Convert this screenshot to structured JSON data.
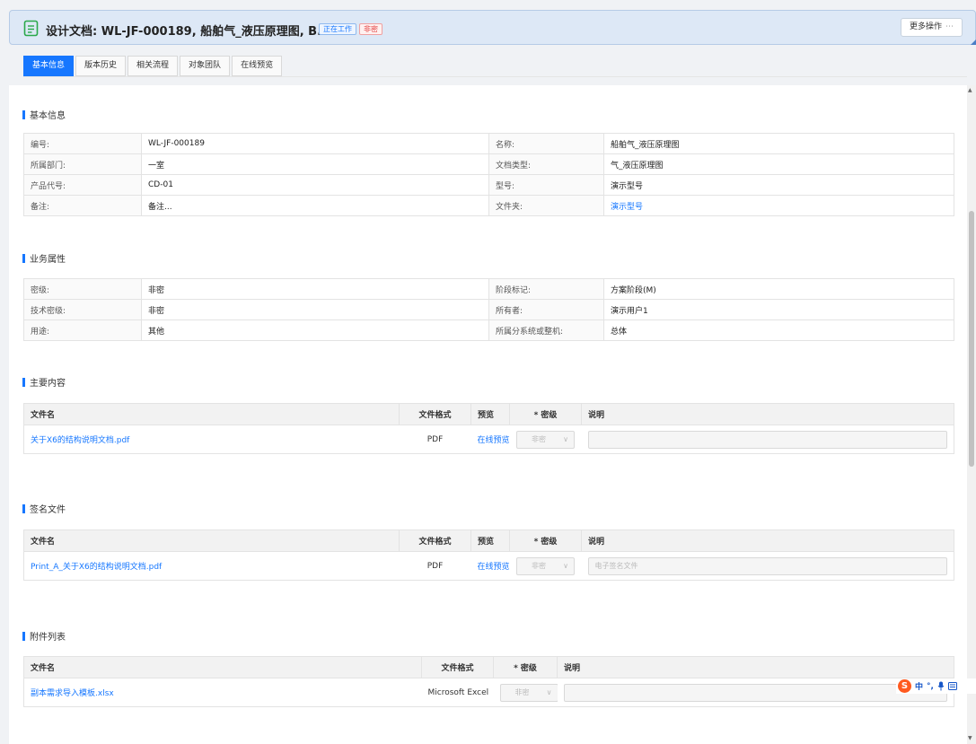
{
  "header": {
    "title": "设计文档: WL-JF-000189, 船舶气_液压原理图, B.1",
    "status_badge": "正在工作",
    "secret_badge": "非密",
    "more_button": "更多操作",
    "more_dots": "⋯",
    "colors": {
      "accent": "#1677ff",
      "header_bg": "#dde8f6",
      "danger": "#e23c3c"
    }
  },
  "tabs": [
    "基本信息",
    "版本历史",
    "相关流程",
    "对象团队",
    "在线预览"
  ],
  "basic_info": {
    "title": "基本信息",
    "rows": [
      {
        "l1": "编号:",
        "v1": "WL-JF-000189",
        "l2": "名称:",
        "v2": "船舶气_液压原理图"
      },
      {
        "l1": "所属部门:",
        "v1": "一室",
        "l2": "文档类型:",
        "v2": "气_液压原理图"
      },
      {
        "l1": "产品代号:",
        "v1": "CD-01",
        "l2": "型号:",
        "v2": "演示型号"
      },
      {
        "l1": "备注:",
        "v1": "备注...",
        "l2": "文件夹:",
        "v2": "演示型号"
      }
    ]
  },
  "business": {
    "title": "业务属性",
    "rows": [
      {
        "l1": "密级:",
        "v1": "非密",
        "l2": "阶段标记:",
        "v2": "方案阶段(M)"
      },
      {
        "l1": "技术密级:",
        "v1": "非密",
        "l2": "所有者:",
        "v2": "演示用户1"
      },
      {
        "l1": "用途:",
        "v1": "其他",
        "l2": "所属分系统或整机:",
        "v2": "总体"
      }
    ]
  },
  "main_content": {
    "title": "主要内容",
    "headers": {
      "name": "文件名",
      "format": "文件格式",
      "preview": "预览",
      "secret": "* 密级",
      "desc": "说明"
    },
    "row": {
      "name": "关于X6的结构说明文档.pdf",
      "format": "PDF",
      "preview": "在线预览",
      "secret": "非密",
      "desc": ""
    }
  },
  "signature": {
    "title": "签名文件",
    "headers": {
      "name": "文件名",
      "format": "文件格式",
      "preview": "预览",
      "secret": "* 密级",
      "desc": "说明"
    },
    "row": {
      "name": "Print_A_关于X6的结构说明文档.pdf",
      "format": "PDF",
      "preview": "在线预览",
      "secret": "非密",
      "desc_placeholder": "电子签名文件"
    }
  },
  "attachments": {
    "title": "附件列表",
    "headers": {
      "name": "文件名",
      "format": "文件格式",
      "secret": "* 密级",
      "desc": "说明"
    },
    "row": {
      "name": "副本需求导入模板.xlsx",
      "format": "Microsoft Excel",
      "secret": "非密",
      "desc": ""
    }
  },
  "ime": {
    "logo": "S",
    "mode": "中",
    "punct": "°,",
    "icons": [
      "microphone-icon",
      "keyboard-icon"
    ]
  }
}
